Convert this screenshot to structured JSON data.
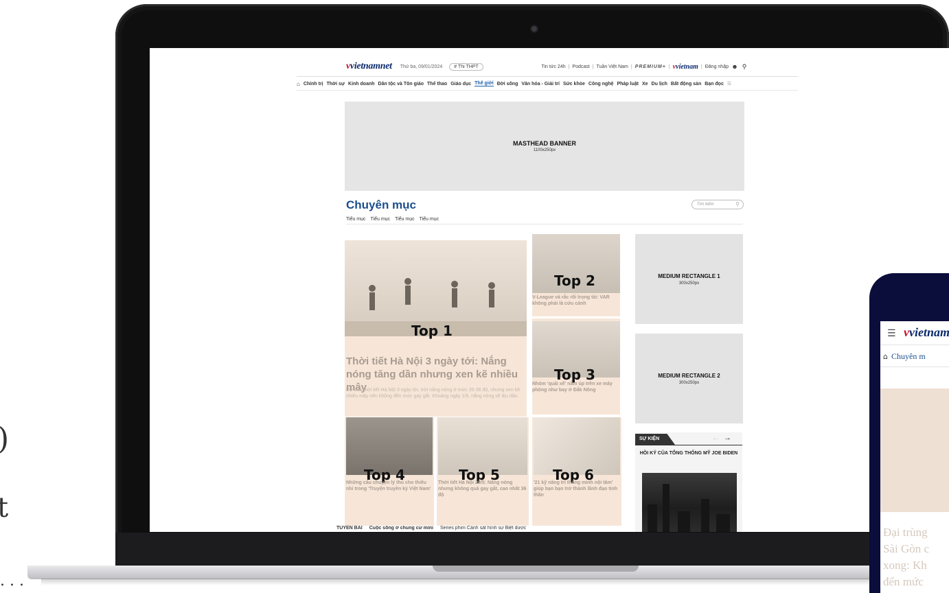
{
  "left_fragments": [
    ")",
    "t",
    ". . ."
  ],
  "site": {
    "logo": "vietnamnet",
    "date": "Thứ ba, 09/01/2024",
    "tag": "# Thi THPT",
    "top_links": [
      "Tin tức 24h",
      "Podcast",
      "Tuần Việt Nam"
    ],
    "premium": "PREMIUM+",
    "login": "Đăng nhập",
    "nav": [
      "Chính trị",
      "Thời sự",
      "Kinh doanh",
      "Dân tộc và Tôn giáo",
      "Thể thao",
      "Giáo dục",
      "Thế giới",
      "Đời sống",
      "Văn hóa - Giải trí",
      "Sức khỏe",
      "Công nghệ",
      "Pháp luật",
      "Xe",
      "Du lịch",
      "Bất động sản",
      "Bạn đọc"
    ],
    "nav_active": "Thế giới",
    "masthead": {
      "title": "MASTHEAD BANNER",
      "size": "1100x250px"
    },
    "section_title": "Chuyên mục",
    "search_placeholder": "Tìm kiếm",
    "subnav": [
      "Tiểu mục",
      "Tiểu mục",
      "Tiểu mục",
      "Tiểu mục"
    ],
    "top1": {
      "label": "Top 1",
      "title": "Thời tiết Hà Nội 3 ngày tới: Nắng nóng tăng dần nhưng xen kẽ nhiều mây",
      "desc": "Dự báo thời tiết Hà Nội 3 ngày tới, trời nắng nóng ở mức 35-36 độ, nhưng xen kẽ nhiều mây nên không đến mức gay gắt. Khoảng ngày 1/6, nắng nóng sẽ dịu dần."
    },
    "top2": {
      "label": "Top 2",
      "title": "V-League và rắc rối trọng tài: VAR không phải là cứu cánh"
    },
    "top3": {
      "label": "Top 3",
      "title": "Nhóm 'quái xế' nằm úp trên xe máy phóng như bay ở Đắk Nông"
    },
    "top4": {
      "label": "Top 4",
      "title": "Những câu chuyện lý thú cho thiếu nhi trong 'Truyện truyền kỳ Việt Nam'"
    },
    "top5": {
      "label": "Top 5",
      "title": "Thời tiết Hà Nội 29/5: Nắng nóng nhưng không quá gay gắt, cao nhất 36 độ"
    },
    "top6": {
      "label": "Top 6",
      "title": "'21 kỹ năng trí thông minh nội tâm' giúp bạn bạn trở thành lãnh đạo tinh thần"
    },
    "ad1": {
      "title": "MEDIUM RECTANGLE 1",
      "size": "300x250px"
    },
    "ad2": {
      "title": "MEDIUM RECTANGLE 2",
      "size": "300x250px"
    },
    "event": {
      "tab": "SỰ KIỆN",
      "title": "HỒI KÝ CỦA TỔNG THỐNG MỸ JOE BIDEN"
    },
    "bottom": {
      "label": "TUYẾN BÀI",
      "item1": "Cuộc sống ở chung cư mini",
      "item2": "Series phim Cảnh sát hình sự Biệt dược"
    }
  },
  "phone": {
    "logo": "vietnam",
    "nav": "Chuyên m",
    "headline": "Đại trùng\nSài Gòn c\nxong: Kh\nđến mức"
  }
}
